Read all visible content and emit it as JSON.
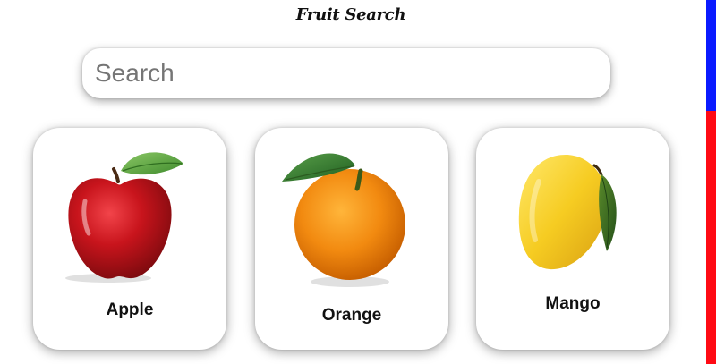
{
  "page": {
    "title": "Fruit Search"
  },
  "search": {
    "placeholder": "Search",
    "value": ""
  },
  "fruits": [
    {
      "name": "Apple",
      "icon": "apple-icon"
    },
    {
      "name": "Orange",
      "icon": "orange-icon"
    },
    {
      "name": "Mango",
      "icon": "mango-icon"
    }
  ],
  "colors": {
    "scrollbar_thumb": "#0a1aff",
    "scrollbar_track_accent": "#ff0a14",
    "card_background": "#ffffff"
  }
}
